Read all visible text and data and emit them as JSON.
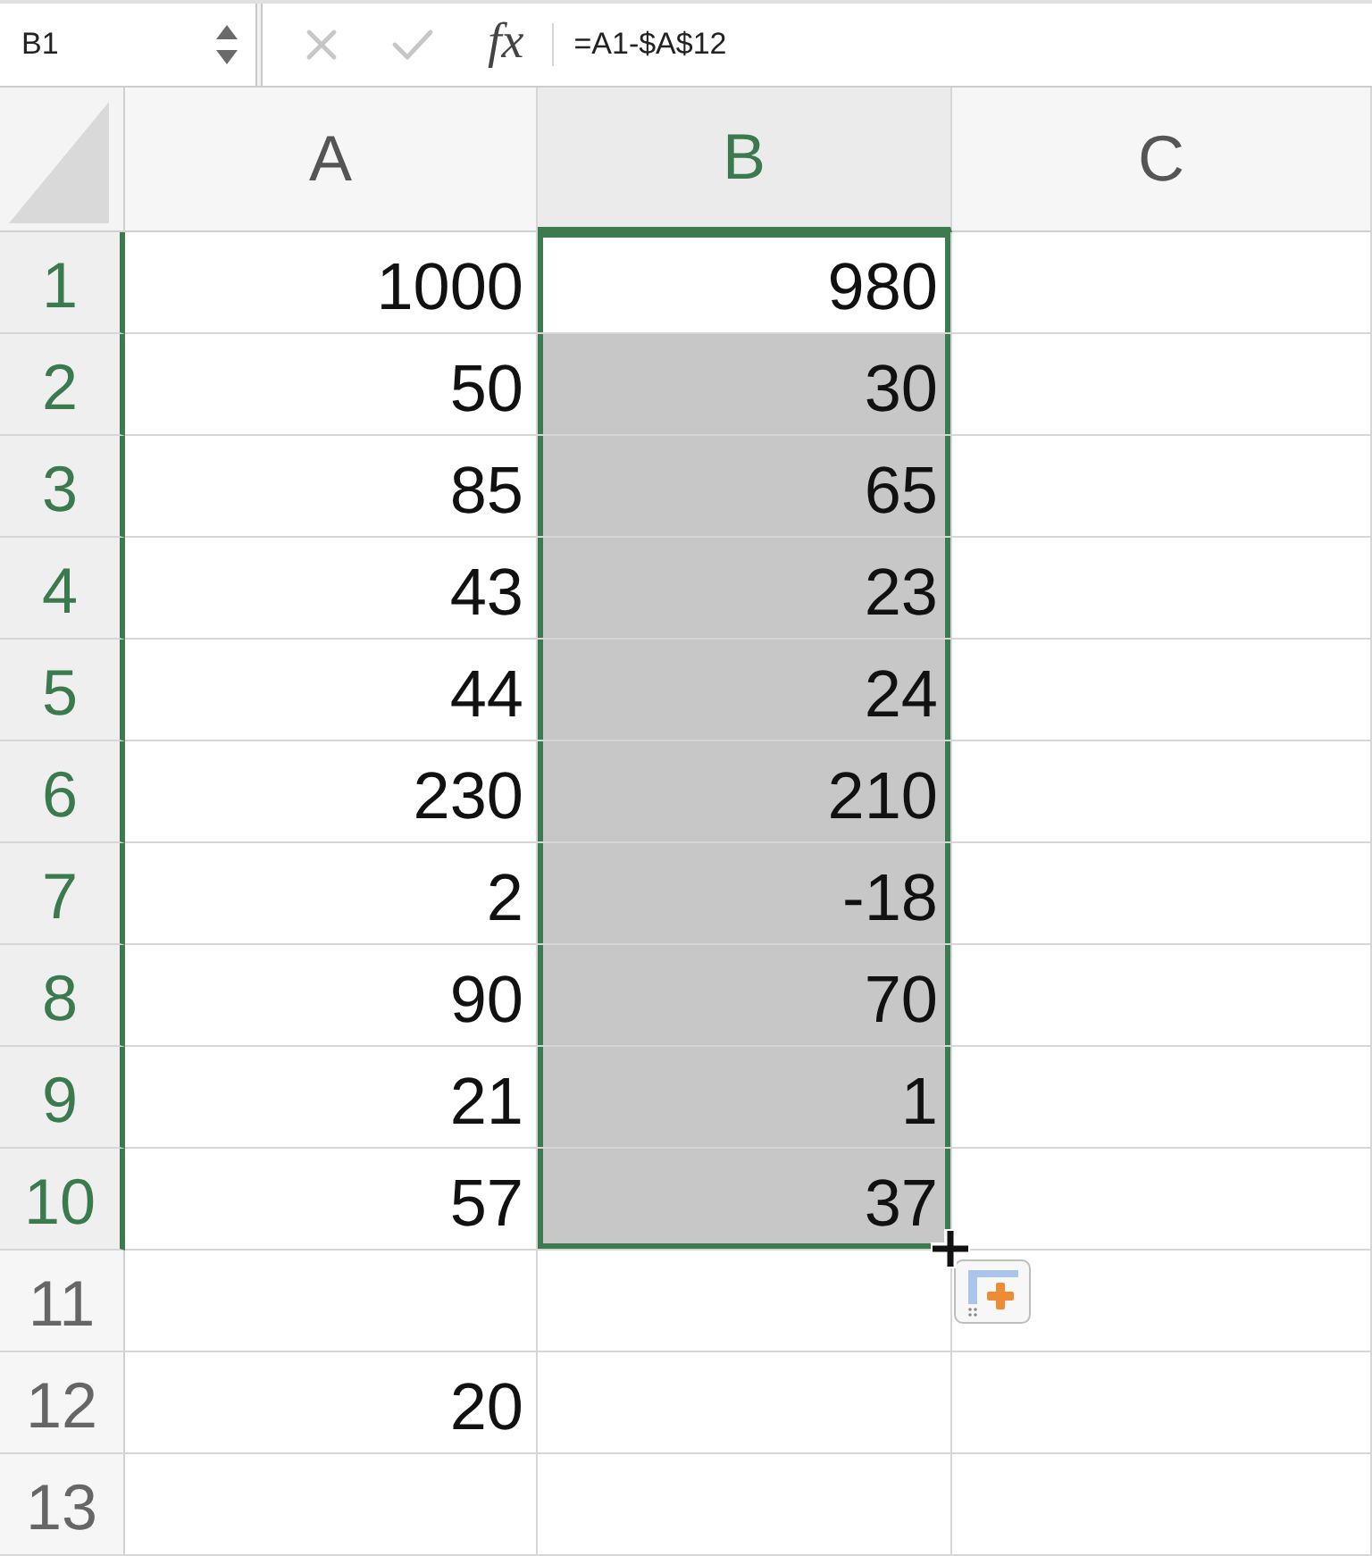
{
  "name_box": {
    "value": "B1"
  },
  "formula_bar": {
    "buttons": [
      {
        "kind": "cancel",
        "disabled": true
      },
      {
        "kind": "enter",
        "disabled": true
      }
    ],
    "insert_function": "fx",
    "formula": "=A1-$A$12"
  },
  "columns": [
    {
      "label": "A",
      "selected": false
    },
    {
      "label": "B",
      "selected": true
    },
    {
      "label": "C",
      "selected": false
    }
  ],
  "rows": [
    {
      "label": "1",
      "selected": true,
      "cells": [
        {
          "value": "1000",
          "selected": false,
          "active": false
        },
        {
          "value": "980",
          "selected": true,
          "active": true
        },
        {
          "selected": false,
          "active": false
        }
      ]
    },
    {
      "label": "2",
      "selected": true,
      "cells": [
        {
          "value": "50",
          "selected": false,
          "active": false
        },
        {
          "value": "30",
          "selected": true,
          "active": false
        },
        {
          "selected": false,
          "active": false
        }
      ]
    },
    {
      "label": "3",
      "selected": true,
      "cells": [
        {
          "value": "85",
          "selected": false,
          "active": false
        },
        {
          "value": "65",
          "selected": true,
          "active": false
        },
        {
          "selected": false,
          "active": false
        }
      ]
    },
    {
      "label": "4",
      "selected": true,
      "cells": [
        {
          "value": "43",
          "selected": false,
          "active": false
        },
        {
          "value": "23",
          "selected": true,
          "active": false
        },
        {
          "selected": false,
          "active": false
        }
      ]
    },
    {
      "label": "5",
      "selected": true,
      "cells": [
        {
          "value": "44",
          "selected": false,
          "active": false
        },
        {
          "value": "24",
          "selected": true,
          "active": false
        },
        {
          "selected": false,
          "active": false
        }
      ]
    },
    {
      "label": "6",
      "selected": true,
      "cells": [
        {
          "value": "230",
          "selected": false,
          "active": false
        },
        {
          "value": "210",
          "selected": true,
          "active": false
        },
        {
          "selected": false,
          "active": false
        }
      ]
    },
    {
      "label": "7",
      "selected": true,
      "cells": [
        {
          "value": "2",
          "selected": false,
          "active": false
        },
        {
          "value": "-18",
          "selected": true,
          "active": false
        },
        {
          "selected": false,
          "active": false
        }
      ]
    },
    {
      "label": "8",
      "selected": true,
      "cells": [
        {
          "value": "90",
          "selected": false,
          "active": false
        },
        {
          "value": "70",
          "selected": true,
          "active": false
        },
        {
          "selected": false,
          "active": false
        }
      ]
    },
    {
      "label": "9",
      "selected": true,
      "cells": [
        {
          "value": "21",
          "selected": false,
          "active": false
        },
        {
          "value": "1",
          "selected": true,
          "active": false
        },
        {
          "selected": false,
          "active": false
        }
      ]
    },
    {
      "label": "10",
      "selected": true,
      "cells": [
        {
          "value": "57",
          "selected": false,
          "active": false
        },
        {
          "value": "37",
          "selected": true,
          "active": false
        },
        {
          "selected": false,
          "active": false
        }
      ]
    },
    {
      "label": "11",
      "selected": false,
      "cells": [
        {
          "selected": false,
          "active": false
        },
        {
          "selected": false,
          "active": false
        },
        {
          "selected": false,
          "active": false
        }
      ]
    },
    {
      "label": "12",
      "selected": false,
      "cells": [
        {
          "value": "20",
          "selected": false,
          "active": false
        },
        {
          "selected": false,
          "active": false
        },
        {
          "selected": false,
          "active": false
        }
      ]
    },
    {
      "label": "13",
      "selected": false,
      "cells": [
        {
          "selected": false,
          "active": false
        },
        {
          "selected": false,
          "active": false
        },
        {
          "selected": false,
          "active": false
        }
      ]
    }
  ]
}
